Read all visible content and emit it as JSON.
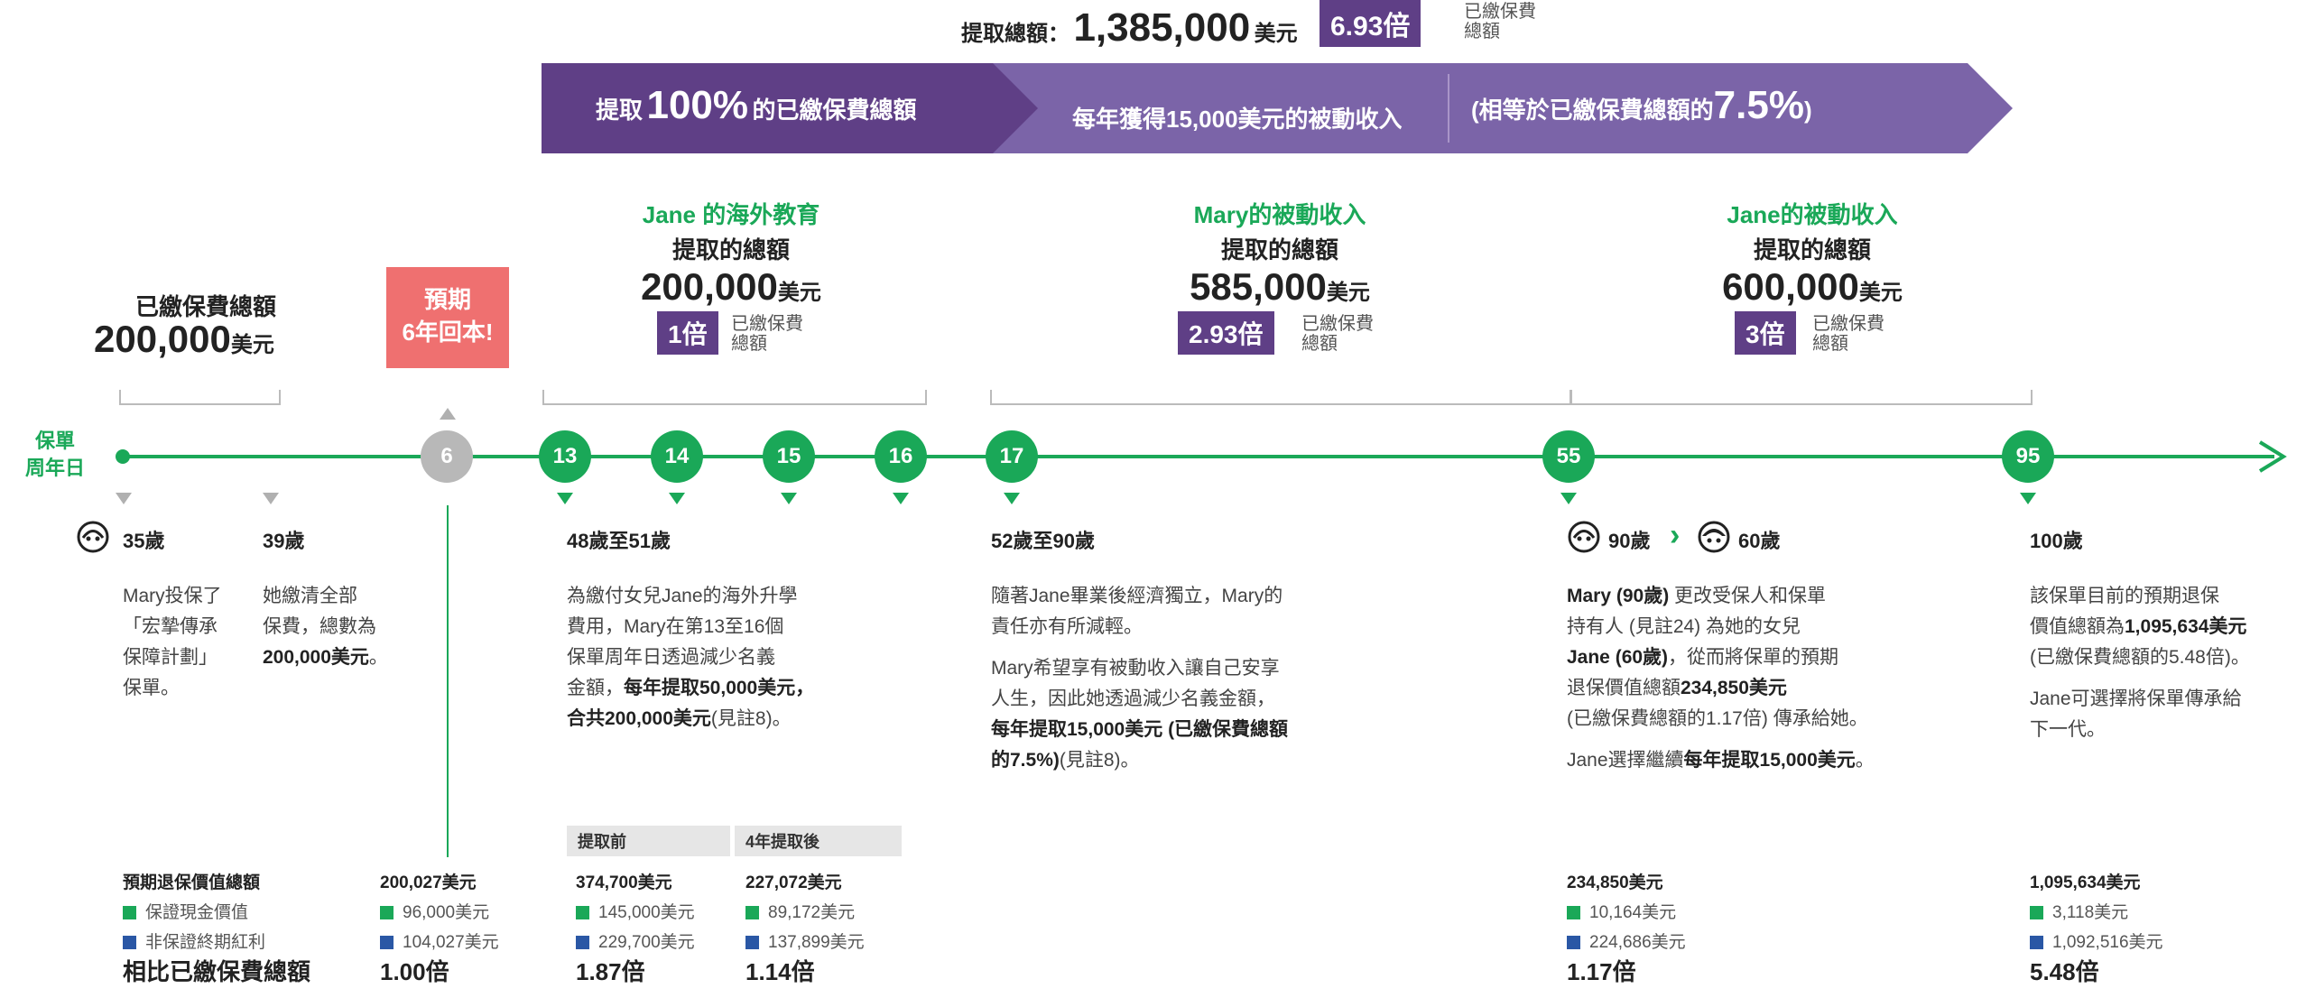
{
  "top_summary": {
    "label": "提取總額：",
    "amount": "1,385,000",
    "unit": "美元",
    "multiple": "6.93倍",
    "multiple_sub1": "已繳保費",
    "multiple_sub2": "總額"
  },
  "banner": {
    "seg1_pre": "提取",
    "seg1_big": "100%",
    "seg1_post": "的已繳保費總額",
    "seg2": "每年獲得15,000美元的被動收入",
    "seg3_pre": "(相等於已繳保費總額的",
    "seg3_big": "7.5%",
    "seg3_post": ")"
  },
  "paid": {
    "label": "已繳保費總額",
    "amount": "200,000",
    "unit": "美元"
  },
  "payback": {
    "line1": "預期",
    "line2": "6年回本!"
  },
  "groups": [
    {
      "cap1": "Jane 的海外教育",
      "cap2": "提取的總額",
      "amount": "200,000",
      "unit": "美元",
      "multiple": "1倍",
      "sub1": "已繳保費",
      "sub2": "總額"
    },
    {
      "cap1": "Mary的被動收入",
      "cap2": "提取的總額",
      "amount": "585,000",
      "unit": "美元",
      "multiple": "2.93倍",
      "sub1": "已繳保費",
      "sub2": "總額"
    },
    {
      "cap1": "Jane的被動收入",
      "cap2": "提取的總額",
      "amount": "600,000",
      "unit": "美元",
      "multiple": "3倍",
      "sub1": "已繳保費",
      "sub2": "總額"
    }
  ],
  "timeline": {
    "label1": "保單",
    "label2": "周年日",
    "nodes": [
      "6",
      "13",
      "14",
      "15",
      "16",
      "17",
      "55",
      "95"
    ]
  },
  "ages": {
    "a35": "35歲",
    "a39": "39歲",
    "a48": "48歲至51歲",
    "a52": "52歲至90歲",
    "a90": "90歲",
    "arrow": "›",
    "a60": "60歲",
    "a100": "100歲"
  },
  "descs": {
    "d35": [
      "Mary投保了",
      "「宏摯傳承",
      "保障計劃」",
      "保單。"
    ],
    "d39": {
      "l1": "她繳清全部",
      "l2": "保費，總數為",
      "l3b": "200,000美元",
      "l3": "。"
    },
    "d48": {
      "l1": "為繳付女兒Jane的海外升學",
      "l2": "費用，Mary在第13至16個",
      "l3": "保單周年日透過減少名義",
      "l4a": "金額，",
      "l4b": "每年提取50,000美元，",
      "l5b": "合共200,000美元",
      "l5": "(見註8)。"
    },
    "d52": {
      "p1l1": "隨著Jane畢業後經濟獨立，Mary的",
      "p1l2": "責任亦有所減輕。",
      "p2l1": "Mary希望享有被動收入讓自己安享",
      "p2l2": "人生，因此她透過減少名義金額，",
      "p2l3b": "每年提取15,000美元 (已繳保費總額",
      "p2l4b": "的7.5%)",
      "p2l4": "(見註8)。"
    },
    "d90": {
      "l1b": "Mary (90歲)",
      "l1": "更改受保人和保單",
      "l2": "持有人 (見註24) 為她的女兒",
      "l3b": "Jane (60歲)",
      "l3": "，從而將保單的預期",
      "l4a": "退保價值總額",
      "l4b": "234,850美元",
      "l5": "(已繳保費總額的1.17倍) 傳承給她。",
      "l6a": "Jane選擇繼續",
      "l6b": "每年提取15,000美元",
      "l6": "。"
    },
    "d100": {
      "l1": "該保單目前的預期退保",
      "l2a": "價值總額為",
      "l2b": "1,095,634美元",
      "l3": "(已繳保費總額的5.48倍)。",
      "l4": "Jane可選擇將保單傳承給",
      "l5": "下一代。"
    }
  },
  "values": {
    "legend_head": "預期退保價值總額",
    "legend_g": "保證現金價值",
    "legend_b": "非保證終期紅利",
    "legend_mult": "相比已繳保費總額",
    "before_label": "提取前",
    "after_label": "4年提取後",
    "cols": [
      {
        "total": "200,027美元",
        "g": "96,000美元",
        "b": "104,027美元",
        "mult": "1.00倍"
      },
      {
        "total": "374,700美元",
        "g": "145,000美元",
        "b": "229,700美元",
        "mult": "1.87倍"
      },
      {
        "total": "227,072美元",
        "g": "89,172美元",
        "b": "137,899美元",
        "mult": "1.14倍"
      },
      {
        "total": "234,850美元",
        "g": "10,164美元",
        "b": "224,686美元",
        "mult": "1.17倍"
      },
      {
        "total": "1,095,634美元",
        "g": "3,118美元",
        "b": "1,092,516美元",
        "mult": "5.48倍"
      }
    ]
  },
  "colors": {
    "green": "#1aa858",
    "purple_dark": "#5f3f86",
    "purple_light": "#7b64a8",
    "coral": "#ef7070",
    "blue": "#2a57a5"
  }
}
